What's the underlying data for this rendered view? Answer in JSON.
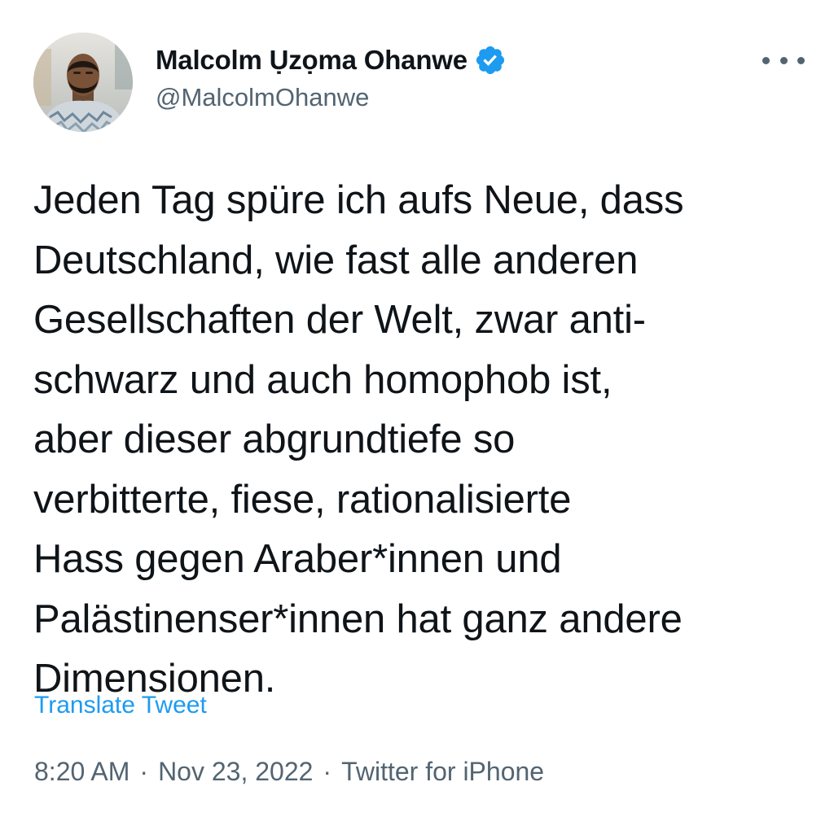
{
  "author": {
    "display_name": "Malcolm Ụzọma Ohanwe",
    "handle": "@MalcolmOhanwe",
    "verified": true,
    "avatar_icon": "profile-photo"
  },
  "more_icon": "more-horizontal-icon",
  "tweet": {
    "text_lines": [
      "Jeden Tag spüre ich aufs Neue, dass",
      "Deutschland, wie fast alle anderen",
      "Gesellschaften der Welt, zwar anti-",
      "schwarz und auch homophob ist,",
      "aber dieser abgrundtiefe so",
      "verbitterte, fiese, rationalisierte",
      "Hass gegen Araber*innen und",
      "Palästinenser*innen hat ganz andere",
      "Dimensionen."
    ],
    "translate_label": "Translate Tweet"
  },
  "meta": {
    "time": "8:20 AM",
    "separator": "·",
    "date": "Nov 23, 2022",
    "source": "Twitter for iPhone"
  },
  "colors": {
    "text_primary": "#0f1419",
    "text_secondary": "#536471",
    "accent": "#1d9bf0"
  }
}
